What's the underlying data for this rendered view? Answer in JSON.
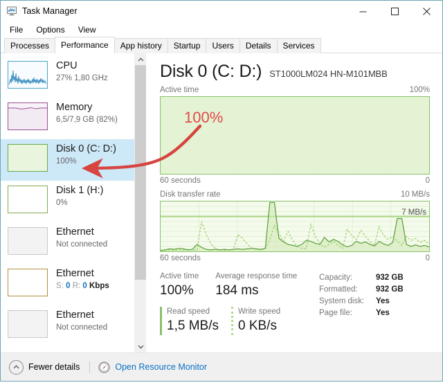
{
  "window": {
    "title": "Task Manager",
    "icon": "task-manager-icon",
    "controls": {
      "minimize": "minimize-icon",
      "maximize": "maximize-icon",
      "close": "close-icon"
    }
  },
  "menu": {
    "items": [
      {
        "label": "File"
      },
      {
        "label": "Options"
      },
      {
        "label": "View"
      }
    ]
  },
  "tabs": {
    "active_index": 1,
    "items": [
      {
        "label": "Processes"
      },
      {
        "label": "Performance"
      },
      {
        "label": "App history"
      },
      {
        "label": "Startup"
      },
      {
        "label": "Users"
      },
      {
        "label": "Details"
      },
      {
        "label": "Services"
      }
    ]
  },
  "sidebar": {
    "scroll": {
      "up_icon": "chevron-up-icon",
      "down_icon": "chevron-down-icon",
      "thumb_percent": 78
    },
    "items": [
      {
        "title": "CPU",
        "sub": "27%  1,80 GHz",
        "sub_parts": {
          "usage": "27%",
          "speed": "1,80 GHz"
        },
        "selected": false,
        "accent": "#4aa3c7",
        "fill": "#f6fbfd",
        "thumb": "cpu-sparkline"
      },
      {
        "title": "Memory",
        "sub": "6,5/7,9 GB (82%)",
        "sub_parts": {
          "used": "6,5",
          "total": "7,9 GB",
          "percent": "(82%)"
        },
        "selected": false,
        "accent": "#9b4f96",
        "fill": "#f7f2f7",
        "thumb": "memory-fill"
      },
      {
        "title": "Disk 0 (C: D:)",
        "sub": "100%",
        "selected": true,
        "accent": "#6aa84f",
        "fill": "#eef7e6",
        "thumb": "disk-fill"
      },
      {
        "title": "Disk 1 (H:)",
        "sub": "0%",
        "selected": false,
        "accent": "#7fab4c",
        "fill": "#ffffff",
        "thumb": "disk-empty"
      },
      {
        "title": "Ethernet",
        "sub": "Not connected",
        "selected": false,
        "accent": "#c8c8c8",
        "fill": "#f3f3f3",
        "thumb": "ethernet-disconnected"
      },
      {
        "title": "Ethernet",
        "sub": "S: 0 R: 0 Kbps",
        "sub_parts": {
          "send_label": "S:",
          "send": "0",
          "recv_label": "R:",
          "recv": "0",
          "unit": "Kbps"
        },
        "selected": false,
        "accent": "#b58a3c",
        "fill": "#ffffff",
        "thumb": "ethernet-active"
      },
      {
        "title": "Ethernet",
        "sub": "Not connected",
        "selected": false,
        "accent": "#c8c8c8",
        "fill": "#f3f3f3",
        "thumb": "ethernet-disconnected"
      }
    ]
  },
  "main": {
    "title": "Disk 0 (C: D:)",
    "model": "ST1000LM024 HN-M101MBB",
    "active_graph": {
      "label": "Active time",
      "max_label": "100%",
      "left_footer": "60 seconds",
      "right_footer": "0"
    },
    "transfer_graph": {
      "label": "Disk transfer rate",
      "max_label": "10 MB/s",
      "inline_marker": "7 MB/s",
      "left_footer": "60 seconds",
      "right_footer": "0"
    },
    "stats": [
      {
        "label": "Active time",
        "value": "100%",
        "marker": "none"
      },
      {
        "label": "Average response time",
        "value": "184 ms",
        "marker": "none"
      },
      {
        "label": "Read speed",
        "value": "1,5 MB/s",
        "marker": "solid"
      },
      {
        "label": "Write speed",
        "value": "0 KB/s",
        "marker": "dotted"
      }
    ],
    "details": [
      {
        "key": "Capacity:",
        "value": "932 GB"
      },
      {
        "key": "Formatted:",
        "value": "932 GB"
      },
      {
        "key": "System disk:",
        "value": "Yes"
      },
      {
        "key": "Page file:",
        "value": "Yes"
      }
    ]
  },
  "statusbar": {
    "fewer_details": "Fewer details",
    "fewer_icon": "chevron-up-circle-icon",
    "resource_monitor": "Open Resource Monitor",
    "resource_monitor_icon": "resource-monitor-icon"
  },
  "annotation": {
    "text": "100%",
    "color": "#e04a4a",
    "arrow": "red-curved-arrow"
  },
  "colors": {
    "accent_green": "#86c166",
    "graph_fill": "#eef7e6",
    "selection": "#cde8f7",
    "link": "#0b6fc4",
    "annotation_red": "#e04a4a"
  },
  "chart_data": [
    {
      "type": "area",
      "title": "Active time",
      "ylabel": "",
      "xlabel": "60 seconds",
      "ylim": [
        0,
        100
      ],
      "y_max_label": "100%",
      "x_left_label": "60 seconds",
      "x_right_label": "0",
      "grid": true,
      "series": [
        {
          "name": "Active time",
          "values": [
            100,
            100,
            100,
            100,
            100,
            100,
            100,
            100,
            100,
            100,
            100,
            100,
            100,
            100,
            100,
            100,
            100,
            100,
            100,
            100,
            100,
            100,
            100,
            100,
            100,
            100,
            100,
            100,
            100,
            100,
            100,
            100,
            100,
            100,
            100,
            100,
            100,
            100,
            100,
            100,
            100,
            100,
            100,
            100,
            100,
            100,
            100,
            100,
            100,
            100,
            100,
            100,
            100,
            100,
            100,
            100,
            100,
            100,
            100,
            100
          ]
        }
      ]
    },
    {
      "type": "line",
      "title": "Disk transfer rate",
      "ylabel": "",
      "xlabel": "60 seconds",
      "ylim": [
        0,
        10
      ],
      "y_max_label": "10 MB/s",
      "marker_line": 7,
      "marker_label": "7 MB/s",
      "x_left_label": "60 seconds",
      "x_right_label": "0",
      "grid": true,
      "series": [
        {
          "name": "Read speed",
          "style": "solid",
          "color": "#5a9e3a",
          "values": [
            0.2,
            0.3,
            0.5,
            0.4,
            0.6,
            0.5,
            0.3,
            0.4,
            1.4,
            0.8,
            0.4,
            0.3,
            0.4,
            0.3,
            0.4,
            0.3,
            0.4,
            0.5,
            0.4,
            0.5,
            0.6,
            0.5,
            0.4,
            0.6,
            9.8,
            9.8,
            2.6,
            1.9,
            1.4,
            1.2,
            1.0,
            1.4,
            2.2,
            2.0,
            1.6,
            1.4,
            2.8,
            1.9,
            2.4,
            2.0,
            1.3,
            0.9,
            1.2,
            2.0,
            1.6,
            1.9,
            1.4,
            1.1,
            2.0,
            1.5,
            1.2,
            1.8,
            6.6,
            6.6,
            1.4,
            1.0,
            1.3,
            1.0,
            1.2,
            0.9
          ]
        },
        {
          "name": "Write speed",
          "style": "dashed",
          "color": "#a4d072",
          "values": [
            0.1,
            0.2,
            0.3,
            0.2,
            0.3,
            0.2,
            0.4,
            0.3,
            0.2,
            6.0,
            3.4,
            1.6,
            0.6,
            0.3,
            0.2,
            0.3,
            0.4,
            3.4,
            2.6,
            1.5,
            0.7,
            0.4,
            0.3,
            0.5,
            2.4,
            5.2,
            3.6,
            2.0,
            4.0,
            2.2,
            1.0,
            0.6,
            0.5,
            5.4,
            3.0,
            1.6,
            0.8,
            1.4,
            2.0,
            1.2,
            0.6,
            4.4,
            3.2,
            2.4,
            4.2,
            3.0,
            2.0,
            1.2,
            5.0,
            3.2,
            2.4,
            3.0,
            2.0,
            1.2,
            3.0,
            2.2,
            2.6,
            1.8,
            2.2,
            1.4
          ]
        }
      ]
    }
  ]
}
